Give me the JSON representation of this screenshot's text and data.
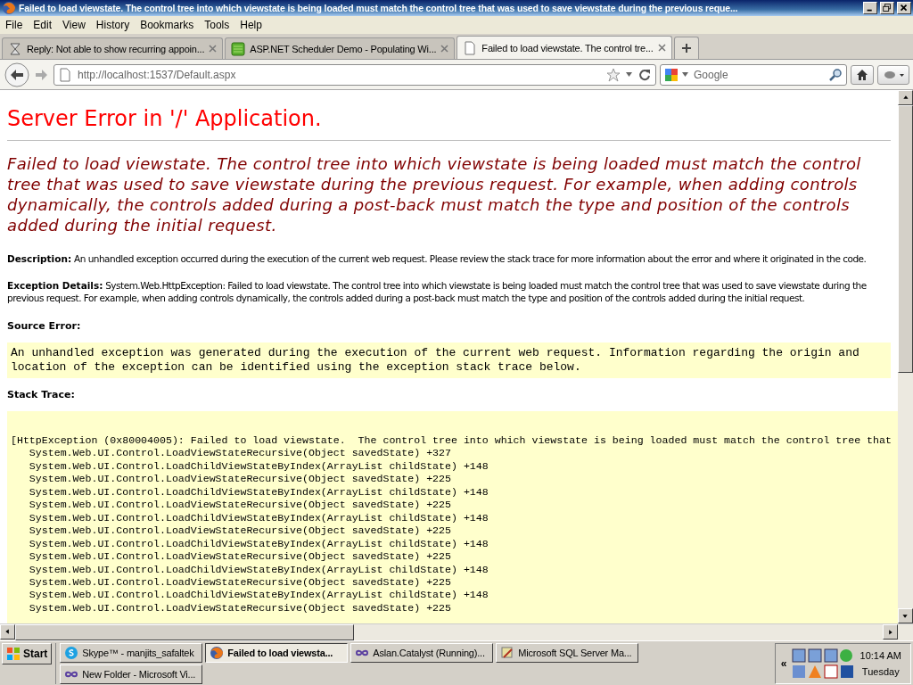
{
  "window": {
    "title": "Failed to load viewstate.  The control tree into which viewstate is being loaded must match the control tree that was used to save viewstate during the previous reque..."
  },
  "menu": [
    "File",
    "Edit",
    "View",
    "History",
    "Bookmarks",
    "Tools",
    "Help"
  ],
  "tabs": [
    {
      "label": "Reply: Not able to show recurring appoin...",
      "selected": false,
      "kind": "reply"
    },
    {
      "label": "ASP.NET Scheduler Demo - Populating Wi...",
      "selected": false,
      "kind": "green"
    },
    {
      "label": "Failed to load viewstate.  The control tre...",
      "selected": true,
      "kind": "page"
    }
  ],
  "address": {
    "value": "http://localhost:1537/Default.aspx"
  },
  "search": {
    "placeholder": "Google"
  },
  "page": {
    "heading": "Server Error in '/' Application.",
    "message": "Failed to load viewstate.  The control tree into which viewstate is being loaded must match the control tree that was used to save viewstate during the previous request.  For example, when adding controls dynamically, the controls added during a post-back must match the type and position of the controls added during the initial request.",
    "description_label": "Description:",
    "description": "An unhandled exception occurred during the execution of the current web request. Please review the stack trace for more information about the error and where it originated in the code.",
    "details_label": "Exception Details:",
    "details": "System.Web.HttpException: Failed to load viewstate.  The control tree into which viewstate is being loaded must match the control tree that was used to save viewstate during the previous request.  For example, when adding controls dynamically, the controls added during a post-back must match the type and position of the controls added during the initial request.",
    "source_label": "Source Error:",
    "source_lines": [
      "An unhandled exception was generated during the execution of the current web request. Information regarding the origin and",
      "location of the exception can be identified using the exception stack trace below."
    ],
    "stack_label": "Stack Trace:",
    "stack_lines": [
      "[HttpException (0x80004005): Failed to load viewstate.  The control tree into which viewstate is being loaded must match the control tree that",
      "   System.Web.UI.Control.LoadViewStateRecursive(Object savedState) +327",
      "   System.Web.UI.Control.LoadChildViewStateByIndex(ArrayList childState) +148",
      "   System.Web.UI.Control.LoadViewStateRecursive(Object savedState) +225",
      "   System.Web.UI.Control.LoadChildViewStateByIndex(ArrayList childState) +148",
      "   System.Web.UI.Control.LoadViewStateRecursive(Object savedState) +225",
      "   System.Web.UI.Control.LoadChildViewStateByIndex(ArrayList childState) +148",
      "   System.Web.UI.Control.LoadViewStateRecursive(Object savedState) +225",
      "   System.Web.UI.Control.LoadChildViewStateByIndex(ArrayList childState) +148",
      "   System.Web.UI.Control.LoadViewStateRecursive(Object savedState) +225",
      "   System.Web.UI.Control.LoadChildViewStateByIndex(ArrayList childState) +148",
      "   System.Web.UI.Control.LoadViewStateRecursive(Object savedState) +225",
      "   System.Web.UI.Control.LoadChildViewStateByIndex(ArrayList childState) +148",
      "   System.Web.UI.Control.LoadViewStateRecursive(Object savedState) +225"
    ]
  },
  "taskbar": {
    "start": "Start",
    "buttons": [
      {
        "label": "Skype™ - manjits_safaltek",
        "selected": false,
        "kind": "skype"
      },
      {
        "label": "Failed to load viewsta...",
        "selected": true,
        "kind": "firefox"
      },
      {
        "label": "Aslan.Catalyst (Running)...",
        "selected": false,
        "kind": "vs"
      },
      {
        "label": "Microsoft SQL Server Ma...",
        "selected": false,
        "kind": "sql"
      },
      {
        "label": "New Folder - Microsoft Vi...",
        "selected": false,
        "kind": "vs"
      }
    ],
    "tray_toggle": "«",
    "time": "10:14 AM",
    "day": "Tuesday"
  }
}
